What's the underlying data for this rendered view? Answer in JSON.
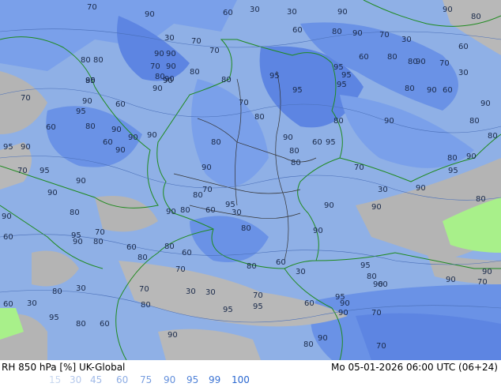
{
  "footer": {
    "left_text": "RH 850 hPa [%] UK-Global",
    "right_text": "Mo 05-01-2026 06:00 UTC (06+24)"
  },
  "legend": [
    {
      "label": "15",
      "color": "#c8d8f0"
    },
    {
      "label": "30",
      "color": "#b4c8ec"
    },
    {
      "label": "45",
      "color": "#a0bae8"
    },
    {
      "label": "60",
      "color": "#8cace4"
    },
    {
      "label": "75",
      "color": "#789ee0"
    },
    {
      "label": "90",
      "color": "#6490dc"
    },
    {
      "label": "95",
      "color": "#5082d8"
    },
    {
      "label": "99",
      "color": "#3c74d4"
    },
    {
      "label": "100",
      "color": "#2866d0"
    }
  ],
  "colors": {
    "map_base": "#8fb0e6",
    "humid_dark": "#5d85e2",
    "humid_mid": "#7aa0ea",
    "dry_gray": "#b4b4b4",
    "very_dry_green": "#a8f08a",
    "border_country": "#1e8a1e",
    "border_state": "#333333"
  },
  "contour_labels": [
    "70",
    "90",
    "60",
    "30",
    "30",
    "90",
    "90",
    "80",
    "70",
    "60",
    "80",
    "90",
    "70",
    "30",
    "30",
    "70",
    "60",
    "80",
    "80",
    "90",
    "90",
    "70",
    "90",
    "80",
    "80",
    "90",
    "95",
    "70",
    "60",
    "80",
    "80",
    "90",
    "70",
    "30",
    "95",
    "95",
    "80",
    "95",
    "80",
    "90",
    "95",
    "90",
    "95",
    "80",
    "90",
    "60",
    "90",
    "60",
    "90",
    "95",
    "70",
    "80",
    "80",
    "90",
    "80",
    "80",
    "60",
    "80",
    "90",
    "90",
    "90",
    "80",
    "90",
    "60",
    "95",
    "80",
    "95",
    "90",
    "70",
    "90",
    "60",
    "80",
    "90",
    "95",
    "70",
    "90",
    "95",
    "90",
    "80",
    "90",
    "70",
    "80",
    "80",
    "60",
    "30",
    "95",
    "90",
    "30",
    "90",
    "80",
    "90",
    "90",
    "80",
    "90",
    "60",
    "95",
    "70",
    "80",
    "90",
    "90",
    "80",
    "80",
    "60",
    "80",
    "60",
    "70",
    "80",
    "60",
    "30",
    "95",
    "80",
    "90",
    "60",
    "30",
    "80",
    "70",
    "30",
    "30",
    "70",
    "90",
    "70",
    "90",
    "30",
    "60",
    "80",
    "60",
    "95",
    "90",
    "90",
    "70",
    "95",
    "80",
    "60",
    "95",
    "95",
    "90",
    "90",
    "80",
    "70"
  ]
}
